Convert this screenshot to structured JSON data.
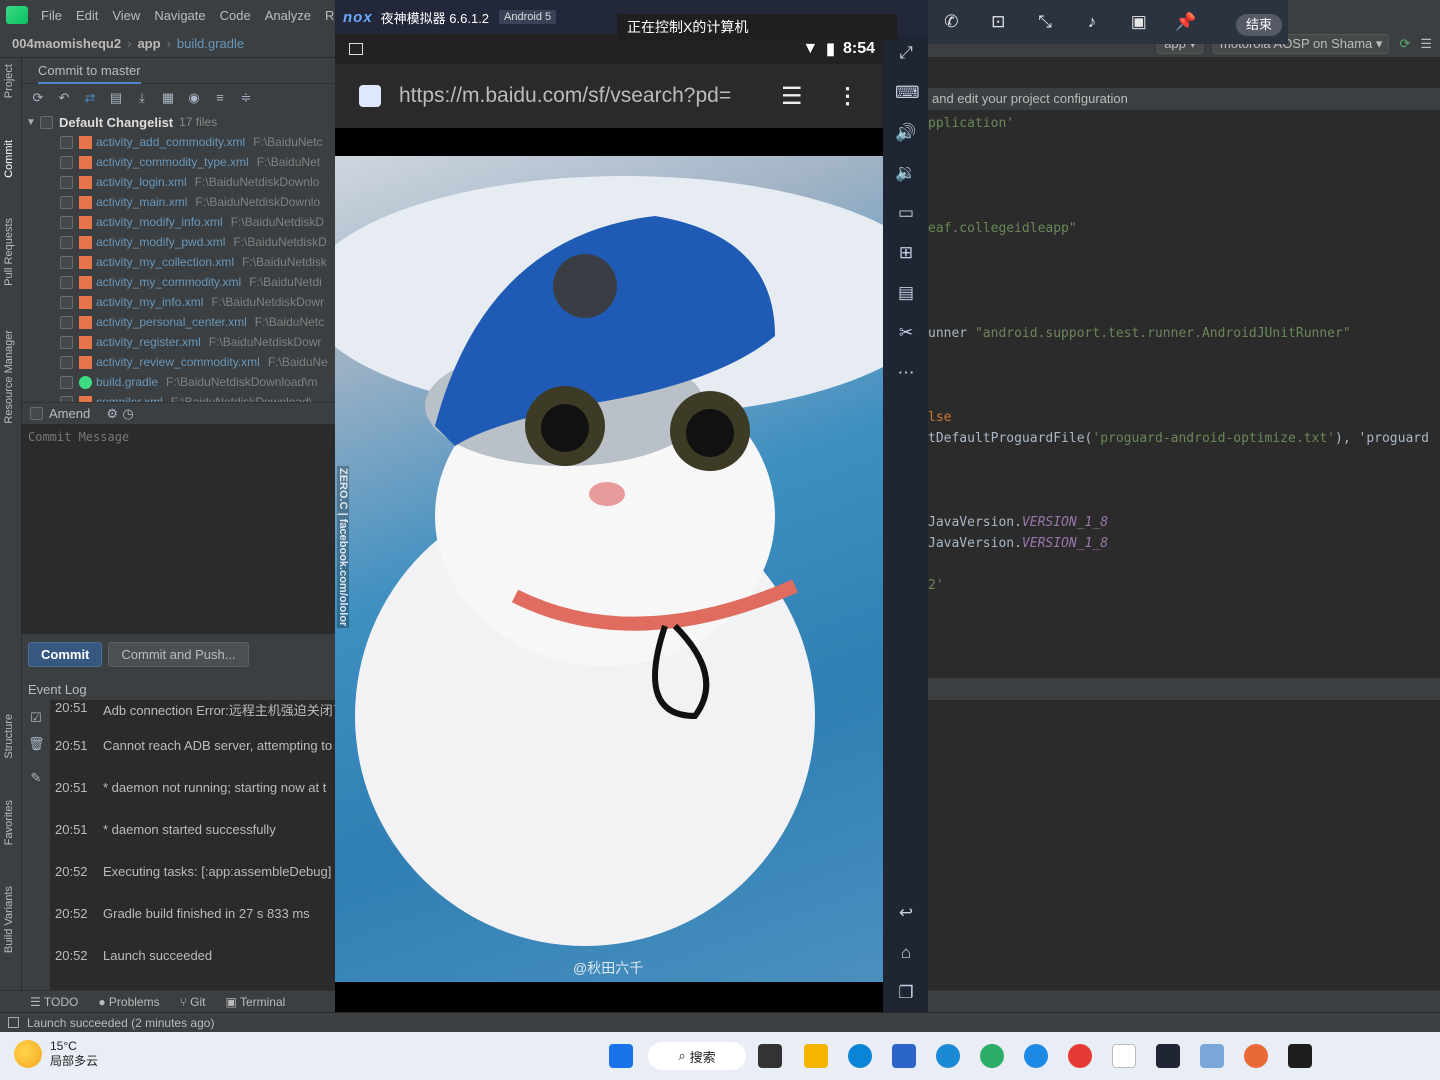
{
  "ide": {
    "menu": [
      "File",
      "Edit",
      "View",
      "Navigate",
      "Code",
      "Analyze",
      "Refac"
    ],
    "breadcrumb": [
      "004maomishequ2",
      "app",
      "build.gradle"
    ],
    "run_config": {
      "module": "app",
      "device": "motorola AOSP on Shama"
    },
    "left_tabs": [
      "Project",
      "Commit",
      "Pull Requests",
      "Resource Manager",
      "Structure",
      "Favorites",
      "Build Variants"
    ],
    "commit_panel": {
      "title": "Commit to master",
      "changelist_name": "Default Changelist",
      "changelist_count": "17 files",
      "files": [
        {
          "name": "activity_add_commodity.xml",
          "path": "F:\\BaiduNetc"
        },
        {
          "name": "activity_commodity_type.xml",
          "path": "F:\\BaiduNet"
        },
        {
          "name": "activity_login.xml",
          "path": "F:\\BaiduNetdiskDownlo"
        },
        {
          "name": "activity_main.xml",
          "path": "F:\\BaiduNetdiskDownlo"
        },
        {
          "name": "activity_modify_info.xml",
          "path": "F:\\BaiduNetdiskD"
        },
        {
          "name": "activity_modify_pwd.xml",
          "path": "F:\\BaiduNetdiskD"
        },
        {
          "name": "activity_my_collection.xml",
          "path": "F:\\BaiduNetdisk"
        },
        {
          "name": "activity_my_commodity.xml",
          "path": "F:\\BaiduNetdi"
        },
        {
          "name": "activity_my_info.xml",
          "path": "F:\\BaiduNetdiskDowr"
        },
        {
          "name": "activity_personal_center.xml",
          "path": "F:\\BaiduNetc"
        },
        {
          "name": "activity_register.xml",
          "path": "F:\\BaiduNetdiskDowr"
        },
        {
          "name": "activity_review_commodity.xml",
          "path": "F:\\BaiduNe"
        },
        {
          "name": "build.gradle",
          "path": "F:\\BaiduNetdiskDownload\\m"
        },
        {
          "name": "compiler.xml",
          "path": "F:\\BaiduNetdiskDownload\\"
        }
      ],
      "amend_label": "Amend",
      "commit_message_placeholder": "Commit Message",
      "commit_button": "Commit",
      "commit_push_button": "Commit and Push..."
    },
    "event_log": {
      "title": "Event Log",
      "entries": [
        {
          "time": "20:51",
          "text": "Adb connection Error:远程主机强迫关闭了"
        },
        {
          "time": "20:51",
          "text": "Cannot reach ADB server, attempting to"
        },
        {
          "time": "20:51",
          "text": "* daemon not running; starting now at t"
        },
        {
          "time": "20:51",
          "text": "* daemon started successfully"
        },
        {
          "time": "20:52",
          "text": "Executing tasks: [:app:assembleDebug]"
        },
        {
          "time": "20:52",
          "text": "Gradle build finished in 27 s 833 ms"
        },
        {
          "time": "20:52",
          "text": "Launch succeeded"
        }
      ]
    },
    "editor": {
      "banner": "and edit your project configuration",
      "lines": [
        {
          "pre": "",
          "str": "pplication'",
          "post": ""
        },
        {
          "pre": "",
          "str": "eaf.collegeidleapp\"",
          "post": ""
        },
        {
          "pre": "unner ",
          "str": "\"android.support.test.runner.AndroidJUnitRunner\"",
          "post": ""
        },
        {
          "pre": "",
          "kw": "lse",
          "post": ""
        },
        {
          "pre": "tDefaultProguardFile(",
          "str": "'proguard-android-optimize.txt'",
          "post": "), 'proguard"
        },
        {
          "pre": "JavaVersion.",
          "ital": "VERSION_1_8",
          "post": ""
        },
        {
          "pre": "JavaVersion.",
          "ital": "VERSION_1_8",
          "post": ""
        },
        {
          "pre": "",
          "str": "2'",
          "post": ""
        }
      ]
    },
    "bottom_tools": [
      "TODO",
      "Problems",
      "Git",
      "Terminal"
    ],
    "status": "Launch succeeded (2 minutes ago)"
  },
  "emulator": {
    "brand": "nox",
    "title": "夜神模拟器 6.6.1.2",
    "android_badge": "Android 5",
    "remote_banner": "正在控制X的计算机",
    "clock": "8:54",
    "url": "https://m.baidu.com/sf/vsearch?pd=",
    "watermark_side": "ZERO.C | facebook.com/ololor",
    "watermark_bottom": "@秋田六千",
    "end_button": "结束"
  },
  "taskbar": {
    "temperature": "15°C",
    "weather": "局部多云",
    "search_label": "搜索"
  },
  "colors": {
    "ide_bg": "#2b2b2b",
    "ide_panel": "#3c3f41",
    "link_blue": "#6897bb",
    "commit_blue": "#365880",
    "taskbar_bg": "#e9eef6"
  }
}
